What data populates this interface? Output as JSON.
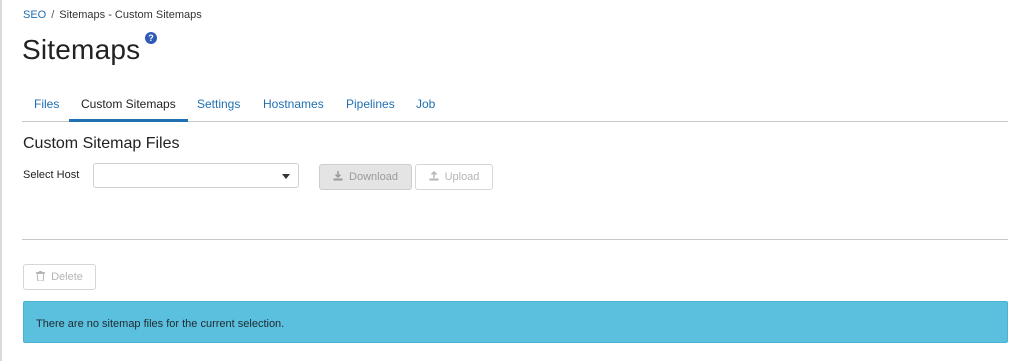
{
  "breadcrumb": {
    "root": "SEO",
    "separator": "/",
    "current": "Sitemaps - Custom Sitemaps"
  },
  "page": {
    "title": "Sitemaps",
    "help_icon": "question-circle-icon",
    "help_glyph": "?"
  },
  "tabs": [
    {
      "label": "Files",
      "active": false
    },
    {
      "label": "Custom Sitemaps",
      "active": true
    },
    {
      "label": "Settings",
      "active": false
    },
    {
      "label": "Hostnames",
      "active": false
    },
    {
      "label": "Pipelines",
      "active": false
    },
    {
      "label": "Job",
      "active": false
    }
  ],
  "section": {
    "title": "Custom Sitemap Files"
  },
  "host_select": {
    "label": "Select Host",
    "value": ""
  },
  "buttons": {
    "download": {
      "label": "Download",
      "icon": "download-icon",
      "disabled": true
    },
    "upload": {
      "label": "Upload",
      "icon": "upload-icon",
      "disabled": true
    },
    "delete": {
      "label": "Delete",
      "icon": "trash-icon",
      "disabled": true
    }
  },
  "alert": {
    "message": "There are no sitemap files for the current selection."
  },
  "colors": {
    "link": "#1f6fb2",
    "alert_bg": "#5bc0de",
    "help_icon": "#2f5bb7"
  }
}
